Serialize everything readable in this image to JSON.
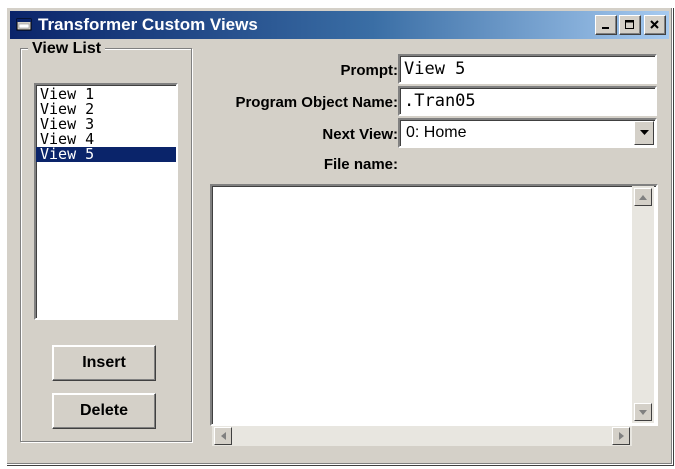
{
  "window": {
    "title": "Transformer Custom Views",
    "minimize_glyph": "_",
    "maximize_glyph": "□",
    "close_glyph": "×"
  },
  "view_list": {
    "legend": "View List",
    "items": [
      "View 1",
      "View 2",
      "View 3",
      "View 4",
      "View 5"
    ],
    "selected_index": 4
  },
  "buttons": {
    "insert": "Insert",
    "delete": "Delete"
  },
  "form": {
    "prompt_label": "Prompt:",
    "prompt_value": "View 5",
    "program_object_label": "Program Object Name:",
    "program_object_value": ".Tran05",
    "next_view_label": "Next View:",
    "next_view_value": "0: Home",
    "file_name_label": "File name:",
    "file_name_value": ""
  },
  "icons": {
    "app": "window-app-icon",
    "dropdown": "chevron-down-icon",
    "scroll_up": "arrow-up-icon",
    "scroll_down": "arrow-down-icon",
    "scroll_left": "arrow-left-icon",
    "scroll_right": "arrow-right-icon"
  },
  "colors": {
    "titlebar_start": "#0a246a",
    "titlebar_end": "#a6caf0",
    "selection": "#0a246a",
    "face": "#d4d0c8"
  }
}
